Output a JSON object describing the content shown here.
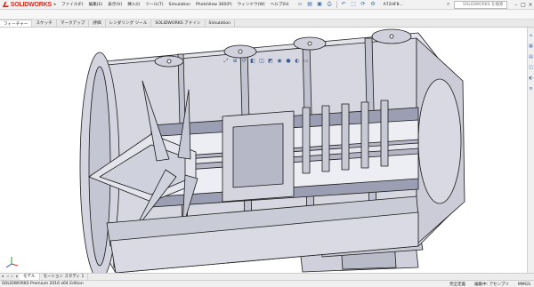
{
  "app": {
    "brand_prefix": "3S",
    "brand": "SOLIDWORKS",
    "document_title": "A72HF8..."
  },
  "menu": {
    "items": [
      "ファイル(F)",
      "編集(E)",
      "表示(V)",
      "挿入(I)",
      "ツール(T)",
      "Simulation",
      "PhotoView 360(P)",
      "ウィンドウ(W)",
      "ヘルプ(H)"
    ]
  },
  "search": {
    "placeholder": "SOLIDWORKS を検索"
  },
  "command_tabs": [
    {
      "label": "フィーチャー",
      "active": true
    },
    {
      "label": "スケッチ",
      "active": false
    },
    {
      "label": "マークアップ",
      "active": false
    },
    {
      "label": "評価",
      "active": false
    },
    {
      "label": "レンダリング ツール",
      "active": false
    },
    {
      "label": "SOLIDWORKS アドイン",
      "active": false
    },
    {
      "label": "Simulation",
      "active": false
    }
  ],
  "model_tabs": [
    {
      "label": "モデル",
      "active": true
    },
    {
      "label": "モーション スタディ 1",
      "active": false
    }
  ],
  "status": {
    "edition": "SOLIDWORKS Premium 2016 x64 Edition",
    "state": "完全定義",
    "mode": "編集中: アセンブリ",
    "units": "MMGS"
  },
  "icons": {
    "toolbar": [
      "new-icon",
      "open-icon",
      "save-icon",
      "print-icon",
      "undo-icon",
      "select-icon",
      "rebuild-icon",
      "options-icon"
    ],
    "hud": [
      "zoom-fit-icon",
      "zoom-area-icon",
      "previous-view-icon",
      "section-view-icon",
      "view-orientation-icon",
      "display-style-icon",
      "hide-show-icon",
      "appearance-icon",
      "scene-icon",
      "view-settings-icon"
    ],
    "taskpane": [
      "resources-icon",
      "design-library-icon",
      "file-explorer-icon",
      "view-palette-icon",
      "appearances-icon",
      "custom-properties-icon"
    ]
  },
  "colors": {
    "brand_red": "#d52b1e",
    "model_fill": "#dcdde6",
    "model_edge": "#1a1a1a",
    "section_fill": "#9c9fb3"
  }
}
